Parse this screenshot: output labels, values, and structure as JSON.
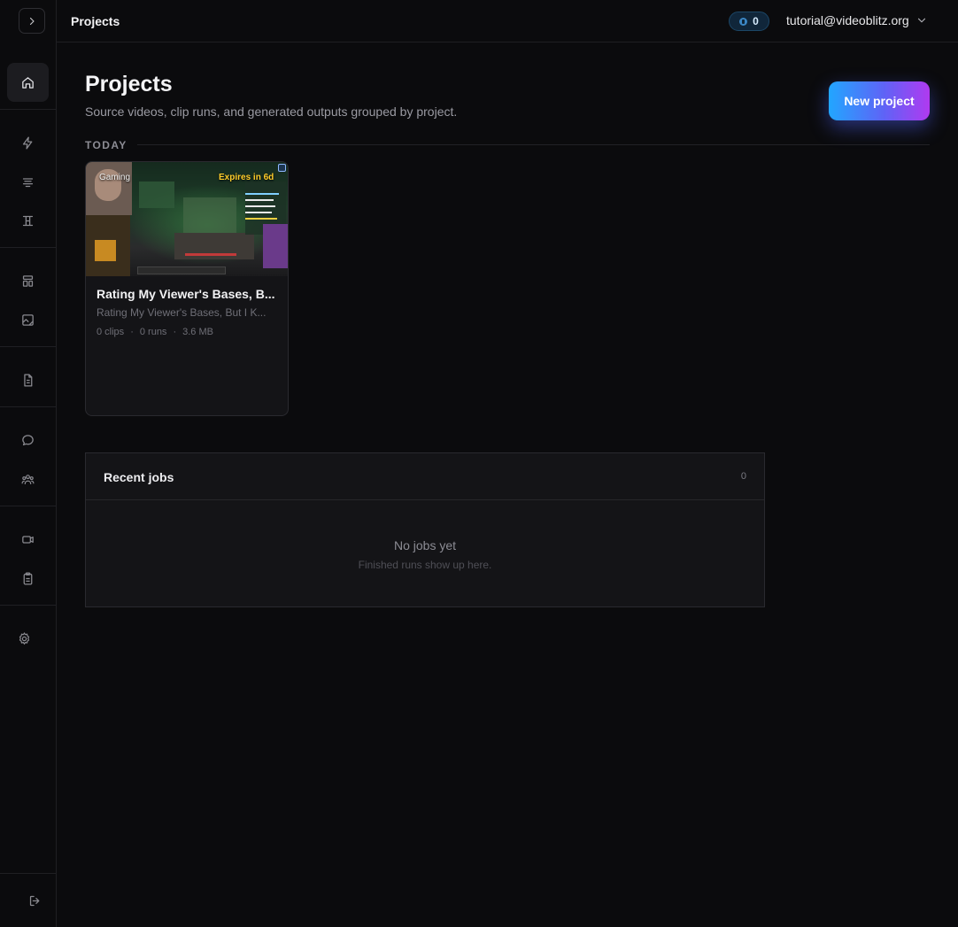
{
  "header": {
    "title": "Projects",
    "credits": "0",
    "user_email": "tutorial@videoblitz.org"
  },
  "sidebar": {
    "items": [
      {
        "icon": "home-icon",
        "active": true
      },
      {
        "icon": "lightning-icon"
      },
      {
        "icon": "filter-lines-icon"
      },
      {
        "icon": "columns-icon"
      },
      {
        "icon": "layout-icon"
      },
      {
        "icon": "image-edit-icon"
      },
      {
        "icon": "document-icon"
      },
      {
        "icon": "chat-icon"
      },
      {
        "icon": "users-icon"
      },
      {
        "icon": "video-camera-icon"
      },
      {
        "icon": "clipboard-icon"
      },
      {
        "icon": "settings-icon"
      },
      {
        "icon": "logout-icon"
      }
    ]
  },
  "main": {
    "title": "Projects",
    "subtitle": "Source videos, clip runs, and generated outputs grouped by project.",
    "new_project_label": "New project",
    "section_label": "TODAY",
    "projects": [
      {
        "tag": "Gaming",
        "expiry": "Expires in 6d",
        "title": "Rating My Viewer's Bases, B...",
        "subtitle": "Rating My Viewer's Bases, But I K...",
        "clips": "0 clips",
        "runs": "0 runs",
        "size": "3.6 MB"
      }
    ]
  },
  "recent_jobs": {
    "title": "Recent jobs",
    "count": "0",
    "empty_title": "No jobs yet",
    "empty_subtitle": "Finished runs show up here."
  },
  "colors": {
    "background": "#0b0b0d",
    "accent_gradient_start": "#22a6ff",
    "accent_gradient_end": "#b03af0",
    "expiry": "#ffcc2a"
  }
}
